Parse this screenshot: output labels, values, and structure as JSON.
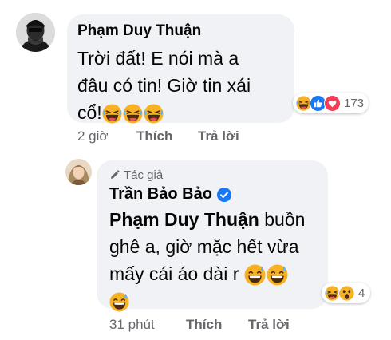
{
  "comments": [
    {
      "author": "Phạm Duy Thuận",
      "lines": [
        "Trời đất! E nói mà a",
        "đâu có tin! Giờ tin xái",
        "cổ!"
      ],
      "reaction_icons": [
        "laughing-emoji",
        "like-icon",
        "love-icon"
      ],
      "reaction_count": "173",
      "time": "2 giờ",
      "like_label": "Thích",
      "reply_label": "Trả lời"
    },
    {
      "badge": "Tác giả",
      "badge_icon": "pencil-icon",
      "author": "Trần Bảo Bảo",
      "verified_icon": "verified-check-icon",
      "mention": "Phạm Duy Thuận",
      "line1_rest": " buồn",
      "lines": [
        "ghê a, giờ mặc hết vừa",
        "mấy cái áo dài r"
      ],
      "reaction_icons": [
        "laughing-emoji",
        "wow-emoji"
      ],
      "reaction_count": "4",
      "time": "31 phút",
      "like_label": "Thích",
      "reply_label": "Trả lời"
    }
  ],
  "colors": {
    "bubble": "#f0f2f5",
    "meta": "#65676b",
    "like": "#1877f2",
    "love": "#f33e58",
    "emoji": "#f7b125"
  }
}
